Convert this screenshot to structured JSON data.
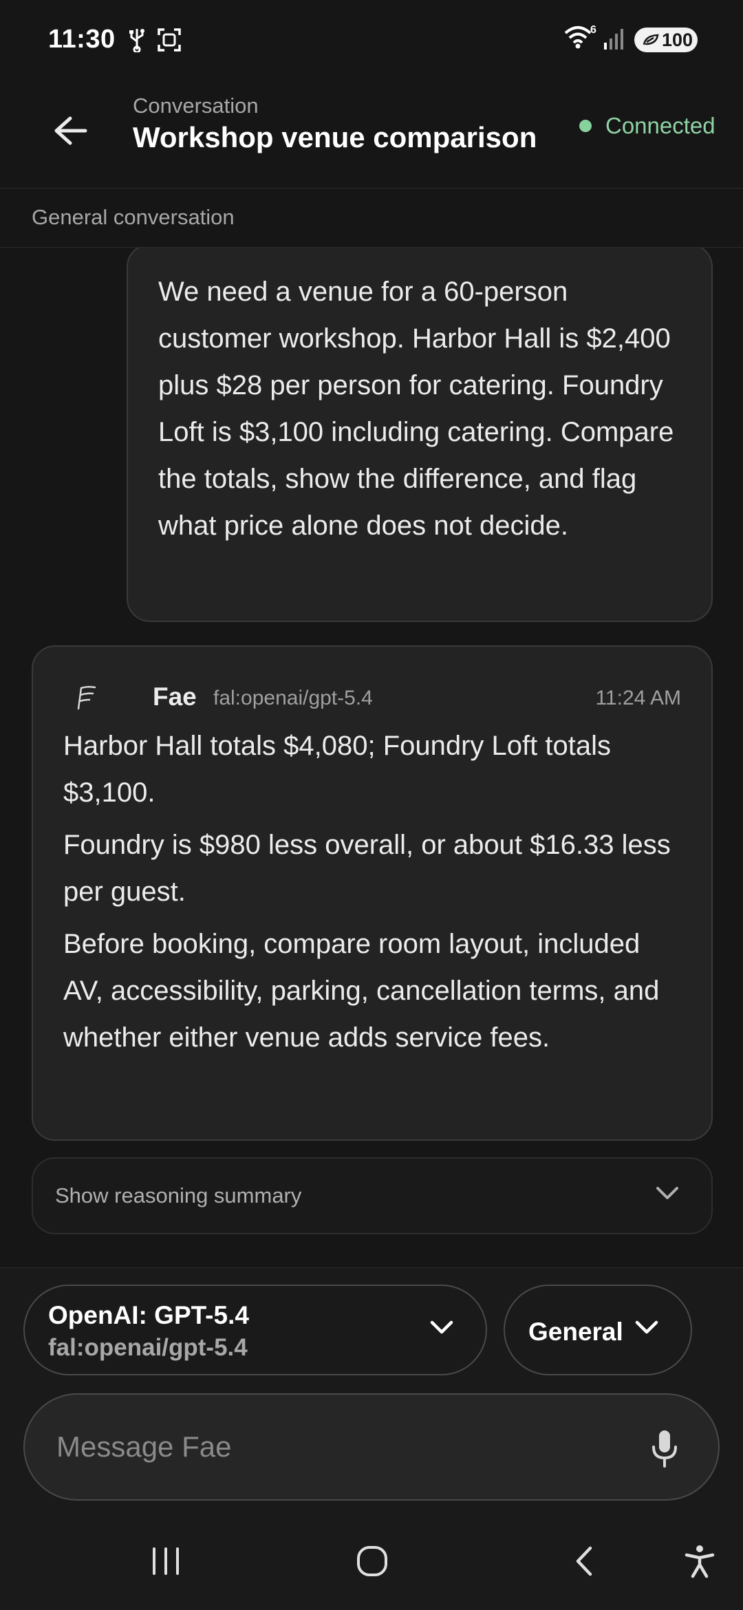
{
  "status_bar": {
    "time": "11:30",
    "signal_badge": "6",
    "battery": "100"
  },
  "header": {
    "subtitle": "Conversation",
    "title": "Workshop venue comparison",
    "connection_status": "Connected",
    "connection_color": "#86d39e"
  },
  "section": {
    "label": "General conversation"
  },
  "messages": {
    "user": {
      "text": "We need a venue for a 60-person customer workshop. Harbor Hall is $2,400 plus $28 per person for catering. Foundry Loft is $3,100 including catering. Compare the totals, show the difference, and flag what price alone does not decide."
    },
    "assistant": {
      "name": "Fae",
      "model": "fal:openai/gpt-5.4",
      "time": "11:24 AM",
      "paragraphs": [
        "Harbor Hall totals $4,080; Foundry Loft totals $3,100.",
        "Foundry is $980 less overall, or about $16.33 less per guest.",
        "Before booking, compare room layout, included AV, accessibility, parking, cancellation terms, and whether either venue adds service fees."
      ]
    },
    "reasoning_toggle": "Show reasoning summary"
  },
  "composer": {
    "model_name": "OpenAI: GPT-5.4",
    "model_id": "fal:openai/gpt-5.4",
    "mode": "General",
    "placeholder": "Message Fae",
    "value": ""
  },
  "icons": {
    "back": "arrow-left-icon",
    "reasoning": "chevron-down-icon",
    "mic": "microphone-icon",
    "nav": [
      "recent-apps-icon",
      "home-icon",
      "nav-back-icon",
      "accessibility-icon"
    ]
  }
}
